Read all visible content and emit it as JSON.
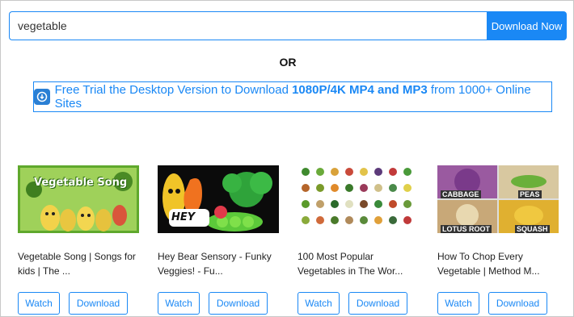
{
  "search": {
    "value": "vegetable",
    "button_label": "Download Now"
  },
  "or_label": "OR",
  "trial": {
    "text_pre": "Free Trial the Desktop Version to Download ",
    "text_bold": "1080P/4K MP4 and MP3",
    "text_post": " from 1000+ Online Sites"
  },
  "videos": [
    {
      "title_line1": "Vegetable Song | Songs for",
      "title_line2": "kids | The ...",
      "thumb_text": "Vegetable Song",
      "watch_label": "Watch",
      "download_label": "Download"
    },
    {
      "title_line1": "Hey Bear Sensory - Funky",
      "title_line2": "Veggies! - Fu...",
      "thumb_text": "HEY",
      "watch_label": "Watch",
      "download_label": "Download"
    },
    {
      "title_line1": "100 Most Popular",
      "title_line2": "Vegetables in The Wor...",
      "watch_label": "Watch",
      "download_label": "Download"
    },
    {
      "title_line1": "How To Chop Every",
      "title_line2": "Vegetable | Method M...",
      "thumb_labels": [
        "CABBAGE",
        "PEAS",
        "LOTUS ROOT",
        "SQUASH"
      ],
      "watch_label": "Watch",
      "download_label": "Download"
    }
  ],
  "colors": {
    "accent": "#1a88f5"
  }
}
